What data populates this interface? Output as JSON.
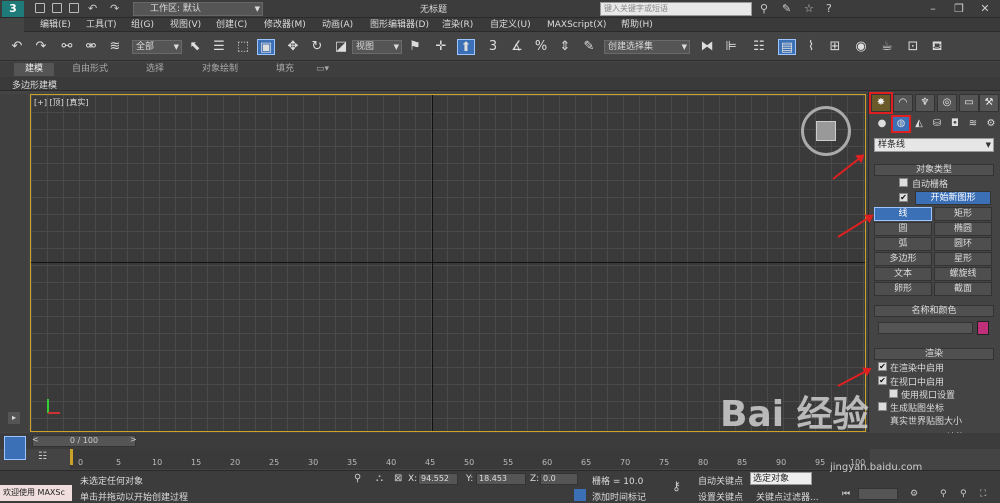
{
  "titlebar": {
    "workspace": "工作区: 默认",
    "window_title": "无标题",
    "search_placeholder": "键入关键字或短语",
    "logo": "3"
  },
  "menu": [
    "编辑(E)",
    "工具(T)",
    "组(G)",
    "视图(V)",
    "创建(C)",
    "修改器(M)",
    "动画(A)",
    "图形编辑器(D)",
    "渲染(R)",
    "自定义(U)",
    "MAXScript(X)",
    "帮助(H)"
  ],
  "toolbar": {
    "filter": "全部",
    "coord": "视图",
    "selection_set": "创建选择集",
    "snap_label": "3"
  },
  "ribbon": {
    "tabs": [
      "建模",
      "自由形式",
      "选择",
      "对象绘制",
      "填充"
    ],
    "subtab": "多边形建模"
  },
  "viewport": {
    "label": "[+] [顶] [真实]"
  },
  "panel": {
    "category": "样条线",
    "object_type_header": "对象类型",
    "auto_grid": "自动栅格",
    "start_new_shape": "开始新图形",
    "buttons": [
      "线",
      "矩形",
      "圆",
      "椭圆",
      "弧",
      "圆环",
      "多边形",
      "星形",
      "文本",
      "螺旋线",
      "卵形",
      "截面"
    ],
    "name_color_header": "名称和颜色",
    "render_header": "渲染",
    "render_opts": [
      "在渲染中启用",
      "在视口中启用",
      "使用视口设置",
      "生成贴图坐标",
      "真实世界贴图大小"
    ],
    "render_label": "渲染",
    "color_swatch": "#c0307a"
  },
  "timeline": {
    "slider": "0 / 100",
    "ticks": [
      "0",
      "5",
      "10",
      "15",
      "20",
      "25",
      "30",
      "35",
      "40",
      "45",
      "50",
      "55",
      "60",
      "65",
      "70",
      "75",
      "80",
      "85",
      "90",
      "95",
      "100"
    ]
  },
  "status": {
    "welcome": "欢迎使用 MAXSc",
    "line1": "未选定任何对象",
    "line2": "单击并拖动以开始创建过程",
    "x_label": "X:",
    "x_val": "94.552",
    "y_label": "Y:",
    "y_val": "18.453",
    "z_label": "Z:",
    "z_val": "0.0",
    "grid": "栅格 = 10.0",
    "add_time_tag": "添加时间标记",
    "auto_key": "自动关键点",
    "selected": "选定对象",
    "set_key": "设置关键点",
    "key_filter": "关键点过滤器..."
  },
  "watermark": {
    "brand": "Bai  经验",
    "url": "jingyan.baidu.com"
  }
}
